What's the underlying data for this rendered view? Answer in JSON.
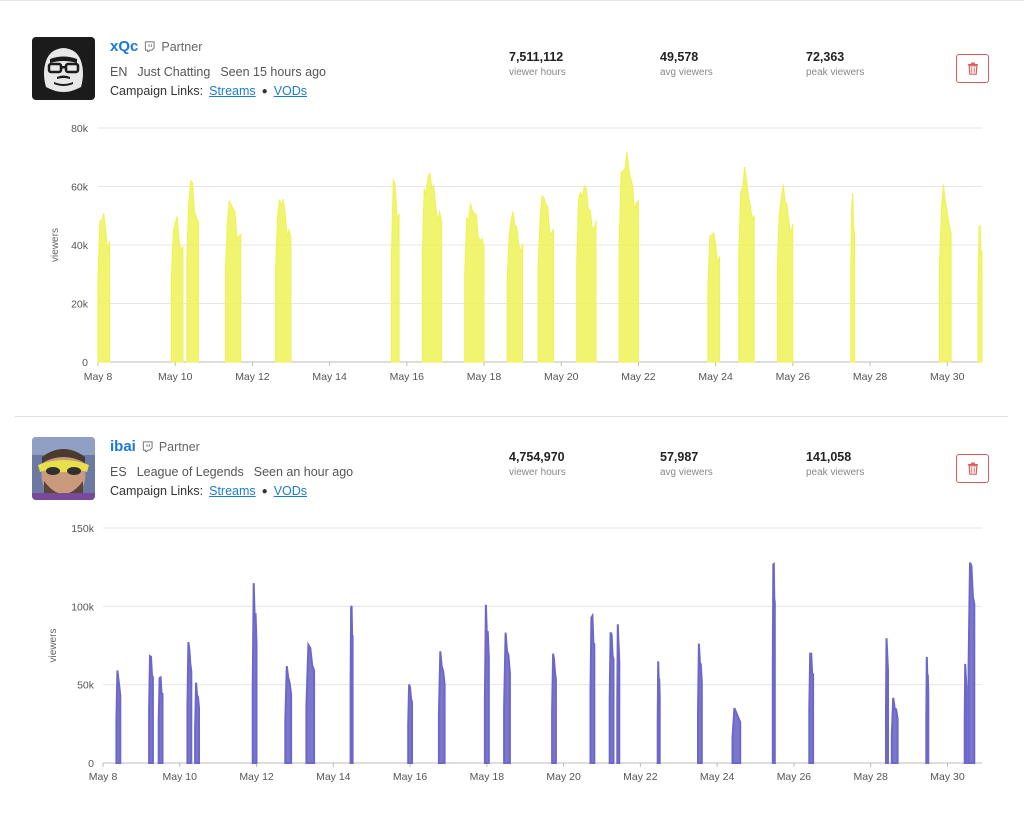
{
  "panels": [
    {
      "streamer": {
        "name": "xQc",
        "badge": "Partner",
        "language": "EN",
        "category": "Just Chatting",
        "last_seen": "Seen 15 hours ago",
        "campaign_links_label": "Campaign Links:",
        "streams_link": "Streams",
        "vods_link": "VODs",
        "avatar": "gorilla-logo"
      },
      "stats": [
        {
          "value": "7,511,112",
          "label": "viewer hours"
        },
        {
          "value": "49,578",
          "label": "avg viewers"
        },
        {
          "value": "72,363",
          "label": "peak viewers"
        }
      ],
      "delete_icon": "trash-icon"
    },
    {
      "streamer": {
        "name": "ibai",
        "badge": "Partner",
        "language": "ES",
        "category": "League of Legends",
        "last_seen": "Seen an hour ago",
        "campaign_links_label": "Campaign Links:",
        "streams_link": "Streams",
        "vods_link": "VODs",
        "avatar": "person-with-sunglasses"
      },
      "stats": [
        {
          "value": "4,754,970",
          "label": "viewer hours"
        },
        {
          "value": "57,987",
          "label": "avg viewers"
        },
        {
          "value": "141,058",
          "label": "peak viewers"
        }
      ],
      "delete_icon": "trash-icon"
    }
  ],
  "chart_data": [
    {
      "type": "area",
      "color": "#eef255",
      "ylabel": "viewers",
      "ylim": [
        0,
        80000
      ],
      "y_ticks": [
        0,
        20000,
        40000,
        60000,
        80000
      ],
      "y_tick_labels": [
        "0",
        "20k",
        "40k",
        "60k",
        "80k"
      ],
      "x_range": [
        8,
        30.9
      ],
      "x_ticks": [
        8,
        10,
        12,
        14,
        16,
        18,
        20,
        22,
        24,
        26,
        28,
        30
      ],
      "x_tick_labels": [
        "May 8",
        "May 10",
        "May 12",
        "May 14",
        "May 16",
        "May 18",
        "May 20",
        "May 22",
        "May 24",
        "May 26",
        "May 28",
        "May 30"
      ],
      "grid": true,
      "series": [
        {
          "streams": [
            {
              "start": 8.0,
              "end": 8.3,
              "peak": 53000
            },
            {
              "start": 9.9,
              "end": 10.2,
              "peak": 51000
            },
            {
              "start": 10.3,
              "end": 10.6,
              "peak": 64000
            },
            {
              "start": 11.3,
              "end": 11.7,
              "peak": 57000
            },
            {
              "start": 12.6,
              "end": 13.0,
              "peak": 58000
            },
            {
              "start": 15.6,
              "end": 15.8,
              "peak": 65000
            },
            {
              "start": 16.4,
              "end": 16.9,
              "peak": 66000
            },
            {
              "start": 17.5,
              "end": 18.0,
              "peak": 55000
            },
            {
              "start": 18.6,
              "end": 19.0,
              "peak": 52000
            },
            {
              "start": 19.4,
              "end": 19.8,
              "peak": 59000
            },
            {
              "start": 20.4,
              "end": 20.9,
              "peak": 62000
            },
            {
              "start": 21.5,
              "end": 22.0,
              "peak": 72000
            },
            {
              "start": 23.8,
              "end": 24.1,
              "peak": 47000
            },
            {
              "start": 24.6,
              "end": 25.0,
              "peak": 67000
            },
            {
              "start": 25.6,
              "end": 26.0,
              "peak": 61000
            },
            {
              "start": 27.5,
              "end": 27.6,
              "peak": 60000
            },
            {
              "start": 29.8,
              "end": 30.1,
              "peak": 61000
            },
            {
              "start": 30.8,
              "end": 30.9,
              "peak": 49000
            }
          ]
        }
      ]
    },
    {
      "type": "area",
      "color": "#6d67c9",
      "ylabel": "viewers",
      "ylim": [
        0,
        150000
      ],
      "y_ticks": [
        0,
        50000,
        100000,
        150000
      ],
      "y_tick_labels": [
        "0",
        "50k",
        "100k",
        "150k"
      ],
      "x_range": [
        8,
        30.9
      ],
      "x_ticks": [
        8,
        10,
        12,
        14,
        16,
        18,
        20,
        22,
        24,
        26,
        28,
        30
      ],
      "x_tick_labels": [
        "May 8",
        "May 10",
        "May 12",
        "May 14",
        "May 16",
        "May 18",
        "May 20",
        "May 22",
        "May 24",
        "May 26",
        "May 28",
        "May 30"
      ],
      "grid": true,
      "series": [
        {
          "streams": [
            {
              "start": 8.35,
              "end": 8.45,
              "peak": 62000
            },
            {
              "start": 9.2,
              "end": 9.3,
              "peak": 75000
            },
            {
              "start": 9.45,
              "end": 9.55,
              "peak": 60000
            },
            {
              "start": 10.2,
              "end": 10.3,
              "peak": 82000
            },
            {
              "start": 10.4,
              "end": 10.5,
              "peak": 52000
            },
            {
              "start": 11.9,
              "end": 12.0,
              "peak": 115000
            },
            {
              "start": 12.75,
              "end": 12.9,
              "peak": 64000
            },
            {
              "start": 13.3,
              "end": 13.5,
              "peak": 82000
            },
            {
              "start": 14.45,
              "end": 14.5,
              "peak": 110000
            },
            {
              "start": 15.95,
              "end": 16.05,
              "peak": 54000
            },
            {
              "start": 16.75,
              "end": 16.9,
              "peak": 73000
            },
            {
              "start": 17.95,
              "end": 18.05,
              "peak": 101000
            },
            {
              "start": 18.45,
              "end": 18.6,
              "peak": 85000
            },
            {
              "start": 19.7,
              "end": 19.8,
              "peak": 75000
            },
            {
              "start": 20.7,
              "end": 20.8,
              "peak": 103000
            },
            {
              "start": 21.2,
              "end": 21.3,
              "peak": 91000
            },
            {
              "start": 21.4,
              "end": 21.45,
              "peak": 92000
            },
            {
              "start": 22.45,
              "end": 22.5,
              "peak": 65000
            },
            {
              "start": 23.5,
              "end": 23.6,
              "peak": 77000
            },
            {
              "start": 24.4,
              "end": 24.6,
              "peak": 37000
            },
            {
              "start": 25.45,
              "end": 25.5,
              "peak": 140000
            },
            {
              "start": 26.4,
              "end": 26.5,
              "peak": 77000
            },
            {
              "start": 28.4,
              "end": 28.45,
              "peak": 84000
            },
            {
              "start": 28.55,
              "end": 28.7,
              "peak": 42000
            },
            {
              "start": 29.45,
              "end": 29.5,
              "peak": 68000
            },
            {
              "start": 30.45,
              "end": 30.5,
              "peak": 66000
            },
            {
              "start": 30.55,
              "end": 30.7,
              "peak": 140000
            }
          ]
        }
      ]
    }
  ]
}
